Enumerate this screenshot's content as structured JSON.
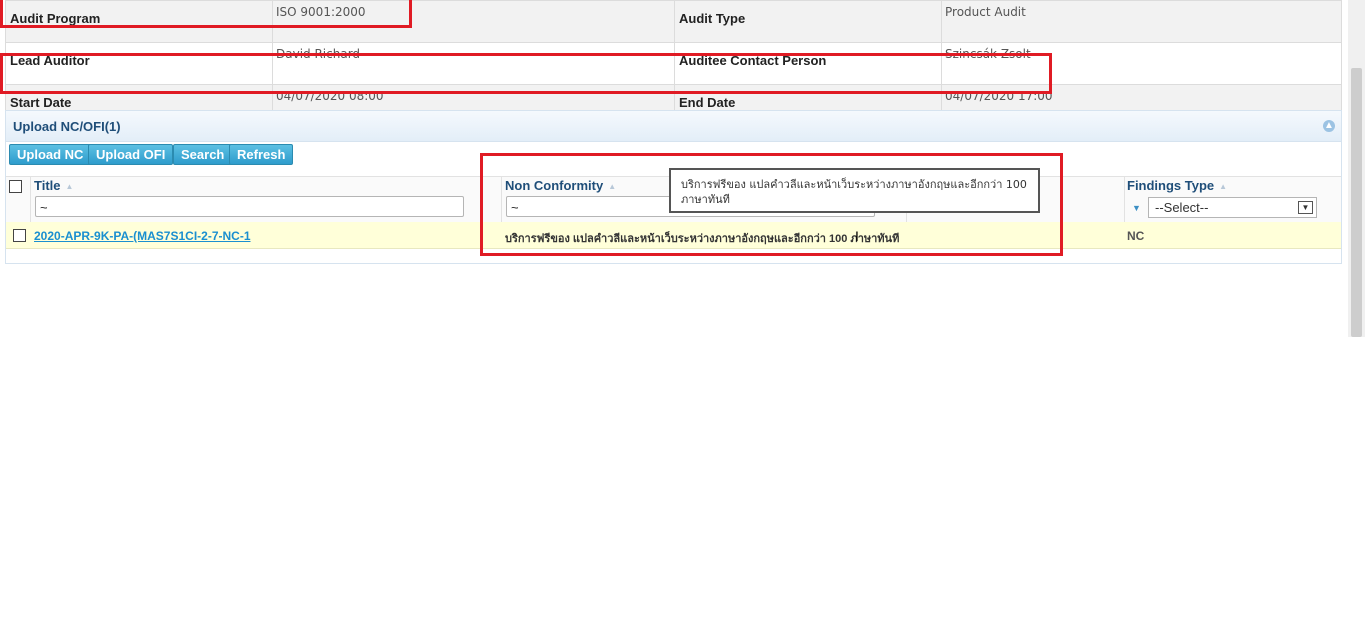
{
  "info": {
    "audit_program_label": "Audit Program",
    "audit_program_value": "ISO 9001:2000",
    "audit_type_label": "Audit Type",
    "audit_type_value": "Product Audit",
    "lead_auditor_label": "Lead Auditor",
    "lead_auditor_value": "David Richard",
    "auditee_label": "Auditee Contact Person",
    "auditee_value": "Szincsák Zsolt",
    "start_date_label": "Start Date",
    "start_date_value": "04/07/2020 08:00",
    "end_date_label": "End Date",
    "end_date_value": "04/07/2020 17:00"
  },
  "panel": {
    "title": "Upload NC/OFI(1)",
    "buttons": {
      "upload_nc": "Upload NC",
      "upload_ofi": "Upload OFI",
      "search": "Search",
      "refresh": "Refresh"
    }
  },
  "grid": {
    "columns": {
      "title": "Title",
      "non_conformity": "Non Conformity",
      "findings_type": "Findings Type"
    },
    "filters": {
      "title": "~",
      "non_conformity": "~",
      "findings_type_select": "--Select--"
    },
    "rows": [
      {
        "title": "2020-APR-9K-PA-(MAS7S1CI-2-7-NC-1",
        "non_conformity": "บริการฟรีของ แปลคำวลีและหน้าเว็บระหว่างภาษาอังกฤษและอีกกว่า 100 ภาษาทันที",
        "findings_type": "NC"
      }
    ]
  },
  "tooltip": {
    "text": "บริการฟรีของ แปลคำวลีและหน้าเว็บระหว่างภาษาอังกฤษและอีกกว่า 100 ภาษาทันที"
  },
  "colors": {
    "header_text": "#1f4e79",
    "link": "#1a8fd0",
    "button": "#2e9ccc",
    "row_highlight": "#ffffd9",
    "annotation_red": "#e01b24"
  }
}
